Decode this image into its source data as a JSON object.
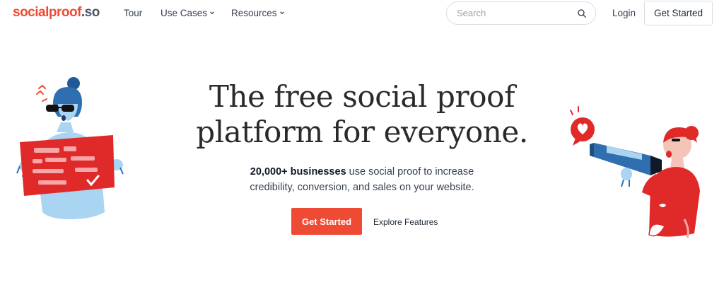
{
  "brand": {
    "name": "socialproof",
    "tld": ".so"
  },
  "nav": {
    "tour": "Tour",
    "use_cases": "Use Cases",
    "resources": "Resources",
    "search_placeholder": "Search",
    "login": "Login",
    "get_started": "Get Started"
  },
  "hero": {
    "title_line1": "The free social proof",
    "title_line2": "platform for everyone.",
    "sub_bold": "20,000+ businesses",
    "sub_rest_line1": " use social proof to increase",
    "sub_line2": "credibility, conversion, and sales on your website.",
    "cta_primary": "Get Started",
    "cta_secondary": "Explore Features"
  },
  "colors": {
    "accent": "#ef4a34",
    "text": "#1f2937",
    "illustration_blue": "#2f6fb0",
    "illustration_light_blue": "#a9d4f2"
  }
}
